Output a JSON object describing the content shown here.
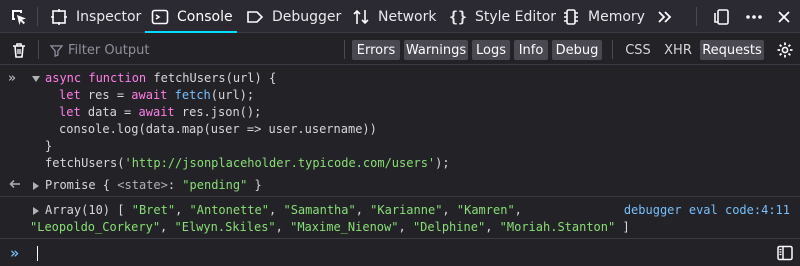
{
  "toolbar": {
    "tabs": [
      {
        "label": "Inspector",
        "icon": "inspector-icon"
      },
      {
        "label": "Console",
        "icon": "console-icon",
        "selected": true
      },
      {
        "label": "Debugger",
        "icon": "debugger-icon"
      },
      {
        "label": "Network",
        "icon": "network-icon"
      },
      {
        "label": "Style Editor",
        "icon": "style-editor-icon"
      },
      {
        "label": "Memory",
        "icon": "memory-icon"
      }
    ],
    "more_tabs_icon": "double-chevron-right-icon",
    "right_icons": [
      "responsive-design-icon",
      "more-menu-icon",
      "close-icon"
    ]
  },
  "filterbar": {
    "filter_placeholder": "Filter Output",
    "levels": [
      {
        "label": "Errors",
        "on": true
      },
      {
        "label": "Warnings",
        "on": true
      },
      {
        "label": "Logs",
        "on": true
      },
      {
        "label": "Info",
        "on": true
      },
      {
        "label": "Debug",
        "on": true
      }
    ],
    "categories": [
      {
        "label": "CSS",
        "on": false
      },
      {
        "label": "XHR",
        "on": false
      },
      {
        "label": "Requests",
        "on": true
      }
    ]
  },
  "console": {
    "input_code": {
      "l1_kw1": "async",
      "l1_kw2": "function",
      "l1_rest": "fetchUsers(url) {",
      "l2_kw": "let",
      "l2_rest_a": "res =",
      "l2_await": "await",
      "l2_fn": "fetch",
      "l2_rest_b": "(url);",
      "l3_kw": "let",
      "l3_rest_a": "data =",
      "l3_await": "await",
      "l3_rest_b": "res.json();",
      "l4_text": "console.log(data.map(user => user.username))",
      "l5_text": "}",
      "l6_fn": "fetchUsers(",
      "l6_str": "'http://jsonplaceholder.typicode.com/users'",
      "l6_end": ");"
    },
    "result": {
      "type_label": "Promise",
      "state_key": "<state>",
      "state_value": "\"pending\""
    },
    "log": {
      "type_label": "Array(10)",
      "items": [
        "\"Bret\"",
        "\"Antonette\"",
        "\"Samantha\"",
        "\"Karianne\"",
        "\"Kamren\"",
        "\"Leopoldo_Corkery\"",
        "\"Elwyn.Skiles\"",
        "\"Maxime_Nienow\"",
        "\"Delphine\"",
        "\"Moriah.Stanton\""
      ],
      "location": "debugger eval code:4:11"
    }
  },
  "input_prompt": "»"
}
